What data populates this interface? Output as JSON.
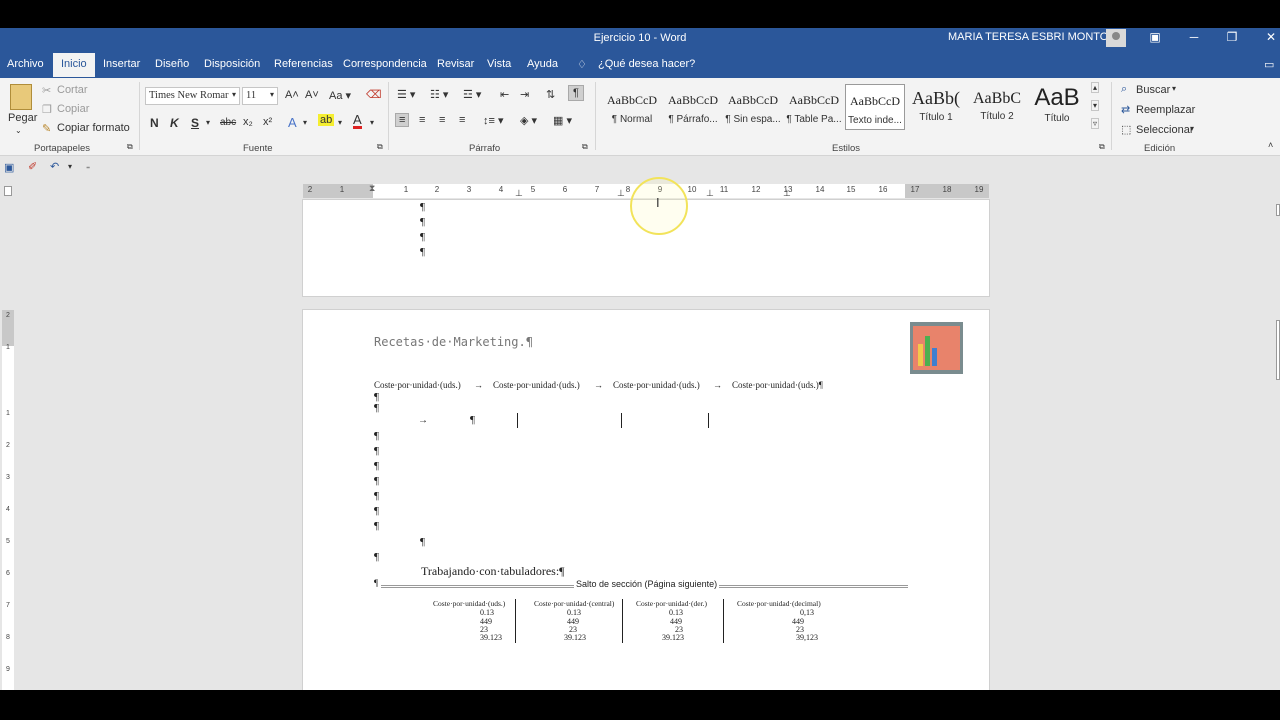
{
  "window": {
    "title": "Ejercicio 10  -  Word",
    "user": "MARIA TERESA ESBRI MONTOLIU"
  },
  "tabs": [
    "Archivo",
    "Inicio",
    "Insertar",
    "Diseño",
    "Disposición",
    "Referencias",
    "Correspondencia",
    "Revisar",
    "Vista",
    "Ayuda"
  ],
  "tell_me": "¿Qué desea hacer?",
  "clipboard": {
    "paste": "Pegar",
    "cut": "Cortar",
    "copy": "Copiar",
    "format_painter": "Copiar formato",
    "group": "Portapapeles"
  },
  "font": {
    "name": "Times New Romar",
    "size": "11",
    "group": "Fuente"
  },
  "paragraph": {
    "group": "Párrafo"
  },
  "styles": {
    "group": "Estilos",
    "items": [
      {
        "sample": "AaBbCcD",
        "name": "¶ Normal"
      },
      {
        "sample": "AaBbCcD",
        "name": "¶ Párrafo..."
      },
      {
        "sample": "AaBbCcD",
        "name": "¶ Sin espa..."
      },
      {
        "sample": "AaBbCcD",
        "name": "¶ Table Pa..."
      },
      {
        "sample": "AaBbCcD",
        "name": "Texto inde..."
      },
      {
        "sample": "AaBb(",
        "name": "Título 1"
      },
      {
        "sample": "AaBbC",
        "name": "Título 2"
      },
      {
        "sample": "AaB",
        "name": "Título"
      }
    ]
  },
  "editing": {
    "find": "Buscar",
    "replace": "Reemplazar",
    "select": "Seleccionar",
    "group": "Edición"
  },
  "ruler": [
    "2",
    "1",
    "1",
    "2",
    "3",
    "4",
    "5",
    "6",
    "7",
    "8",
    "9",
    "10",
    "11",
    "12",
    "13",
    "14",
    "15",
    "16",
    "17",
    "18",
    "19"
  ],
  "vruler": [
    "2",
    "1",
    "1",
    "2",
    "3",
    "4",
    "5",
    "6",
    "7",
    "8",
    "9"
  ],
  "document": {
    "pilcrow": "¶",
    "arrow": "→",
    "heading": "Recetas·de·Marketing.¶",
    "tab_line": [
      "Coste·por·unidad·(uds.)",
      "→",
      "Coste·por·unidad·(uds.)",
      "→",
      "Coste·por·unidad·(uds.)",
      "→",
      "Coste·por·unidad·(uds.)¶"
    ],
    "section_title": "Trabajando·con·tabuladores:¶",
    "section_break": "Salto de sección (Página siguiente)",
    "table_headers": [
      "Coste·por·unidad·(uds.)",
      "Coste·por·unidad·(central)",
      "Coste·por·unidad·(der.)",
      "Coste·por·unidad·(decimal)"
    ],
    "table_rows": [
      [
        "0.13",
        "0.13",
        "0.13",
        "0,13"
      ],
      [
        "449",
        "449",
        "449",
        "449"
      ],
      [
        "23",
        "23",
        "23",
        "23"
      ],
      [
        "39.123",
        "39.123",
        "39.123",
        "39,123"
      ]
    ]
  },
  "colors": {
    "word_blue": "#2b579a",
    "ribbon": "#f3f3f3",
    "canvas": "#e6e6e6",
    "highlight": "#f2e35a"
  }
}
